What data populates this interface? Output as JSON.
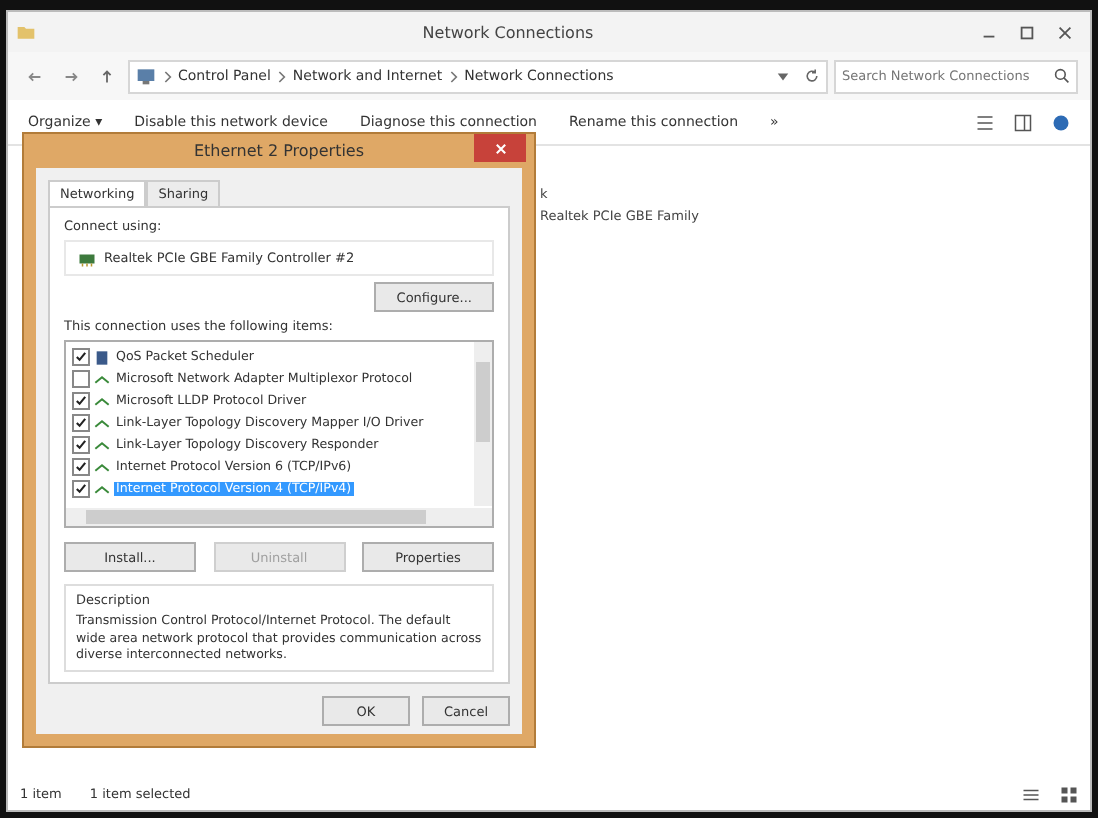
{
  "window": {
    "title": "Network Connections"
  },
  "address_bar": {
    "path": [
      "Control Panel",
      "Network and Internet",
      "Network Connections"
    ],
    "search_placeholder": "Search Network Connections"
  },
  "command_bar": {
    "items": [
      "Organize ▾",
      "Disable this network device",
      "Diagnose this connection",
      "Rename this connection"
    ],
    "overflow": "»"
  },
  "content": {
    "item_lines": [
      "k",
      "Realtek PCIe GBE Family"
    ]
  },
  "status_bar": {
    "count": "1 item",
    "selected": "1 item selected"
  },
  "dialog": {
    "title": "Ethernet 2 Properties",
    "tabs": [
      {
        "label": "Networking",
        "selected": true
      },
      {
        "label": "Sharing",
        "selected": false
      }
    ],
    "connect_using_label": "Connect using:",
    "adapter": "Realtek PCIe GBE Family Controller #2",
    "configure_button": "Configure...",
    "items_label": "This connection uses the following items:",
    "items": [
      {
        "label": "QoS Packet Scheduler",
        "checked": true,
        "selected": false
      },
      {
        "label": "Microsoft Network Adapter Multiplexor Protocol",
        "checked": false,
        "selected": false
      },
      {
        "label": "Microsoft LLDP Protocol Driver",
        "checked": true,
        "selected": false
      },
      {
        "label": "Link-Layer Topology Discovery Mapper I/O Driver",
        "checked": true,
        "selected": false
      },
      {
        "label": "Link-Layer Topology Discovery Responder",
        "checked": true,
        "selected": false
      },
      {
        "label": "Internet Protocol Version 6 (TCP/IPv6)",
        "checked": true,
        "selected": false
      },
      {
        "label": "Internet Protocol Version 4 (TCP/IPv4)",
        "checked": true,
        "selected": true
      }
    ],
    "buttons": [
      {
        "label": "Install...",
        "disabled": false
      },
      {
        "label": "Uninstall",
        "disabled": true
      },
      {
        "label": "Properties",
        "disabled": false
      }
    ],
    "description_label": "Description",
    "description": "Transmission Control Protocol/Internet Protocol. The default wide area network protocol that provides communication across diverse interconnected networks.",
    "footer_buttons": [
      "OK",
      "Cancel"
    ]
  }
}
